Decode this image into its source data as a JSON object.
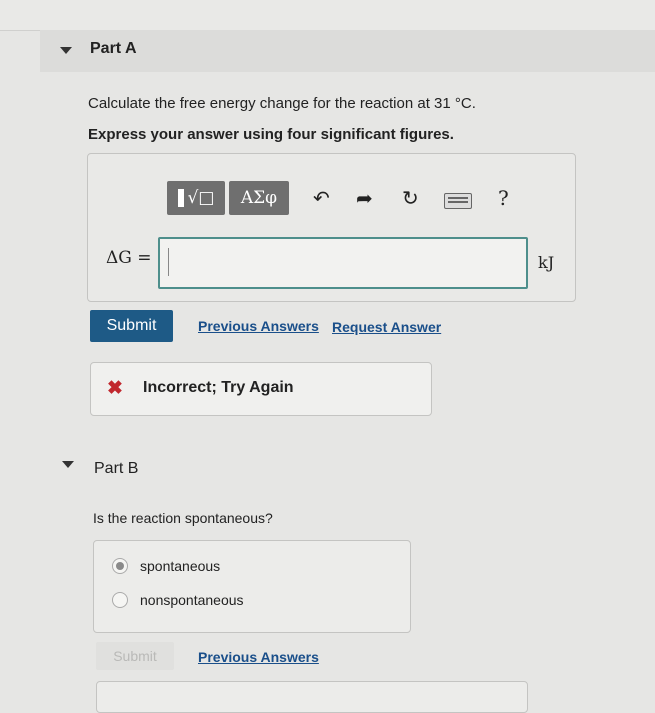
{
  "partA": {
    "title": "Part A",
    "question": "Calculate the free energy change for the reaction at 31 °C.",
    "instruction": "Express your answer using four significant figures.",
    "toolbar": {
      "templates_label": "√□",
      "greek_label": "ΑΣφ",
      "undo_icon": "↶",
      "redo_icon": "➦",
      "reset_icon": "↻",
      "keyboard_icon": "keyboard-icon",
      "help_label": "?"
    },
    "input_label": "ΔG =",
    "input_value": "",
    "unit": "kJ",
    "submit_label": "Submit",
    "previous_answers": "Previous Answers",
    "request_answer": "Request Answer",
    "feedback_icon": "✖",
    "feedback_text": "Incorrect; Try Again"
  },
  "partB": {
    "title": "Part B",
    "question": "Is the reaction spontaneous?",
    "options": [
      {
        "label": "spontaneous",
        "selected": true
      },
      {
        "label": "nonspontaneous",
        "selected": false
      }
    ],
    "submit_label": "Submit",
    "previous_answers": "Previous Answers"
  },
  "colors": {
    "submit_bg": "#1e5a86",
    "link": "#1a4f8a",
    "input_border": "#4e8f8c",
    "incorrect": "#c1272d"
  }
}
